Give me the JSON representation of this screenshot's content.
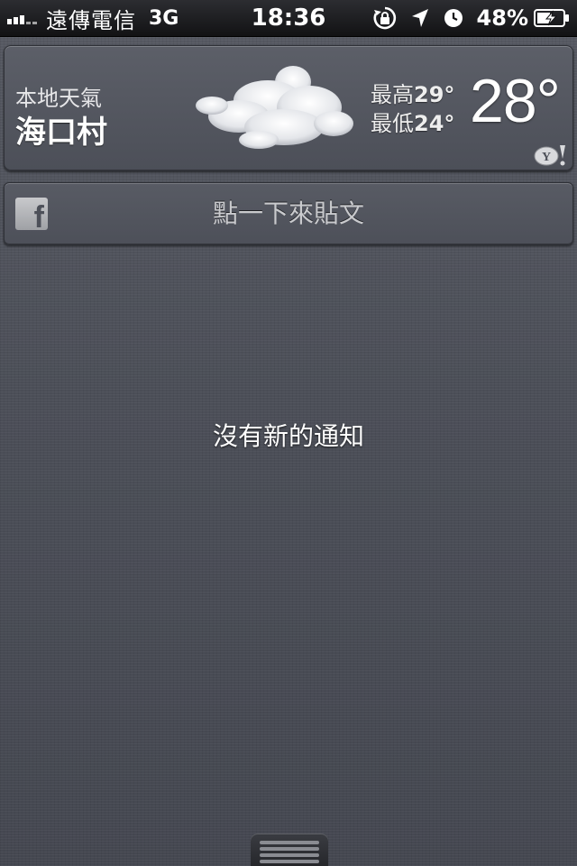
{
  "status_bar": {
    "carrier": "遠傳電信",
    "network": "3G",
    "time": "18:36",
    "battery_percent": "48%",
    "icons": [
      "signal-bars-icon",
      "rotation-lock-icon",
      "location-arrow-icon",
      "alarm-clock-icon",
      "battery-charging-icon"
    ]
  },
  "weather": {
    "label": "本地天氣",
    "city": "海口村",
    "high_label": "最高",
    "high_value": "29°",
    "low_label": "最低",
    "low_value": "24°",
    "current_temp": "28°",
    "condition_icon": "cloud-icon",
    "provider_icon": "yahoo-logo-icon"
  },
  "facebook": {
    "icon": "facebook-icon",
    "post_prompt": "點一下來貼文"
  },
  "notifications": {
    "empty_message": "沒有新的通知"
  },
  "colors": {
    "background": "#4d5059",
    "status_bar": "#121214",
    "text": "#ffffff"
  }
}
